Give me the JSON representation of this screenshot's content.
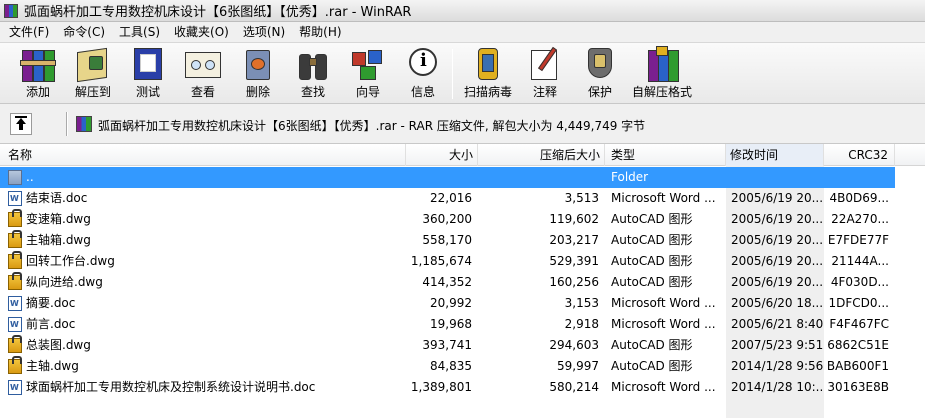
{
  "window": {
    "title": "弧面蜗杆加工专用数控机床设计【6张图纸】【优秀】.rar - WinRAR"
  },
  "menu": [
    "文件(F)",
    "命令(C)",
    "工具(S)",
    "收藏夹(O)",
    "选项(N)",
    "帮助(H)"
  ],
  "toolbar": {
    "buttons": [
      {
        "label": "添加",
        "icon": "add-books-icon"
      },
      {
        "label": "解压到",
        "icon": "extract-folder-icon"
      },
      {
        "label": "测试",
        "icon": "test-check-icon"
      },
      {
        "label": "查看",
        "icon": "view-glasses-icon"
      },
      {
        "label": "删除",
        "icon": "delete-recycle-icon"
      },
      {
        "label": "查找",
        "icon": "find-binoculars-icon"
      },
      {
        "label": "向导",
        "icon": "wizard-icon"
      },
      {
        "label": "信息",
        "icon": "info-icon"
      },
      {
        "label": "扫描病毒",
        "icon": "scan-virus-icon"
      },
      {
        "label": "注释",
        "icon": "comment-pen-icon"
      },
      {
        "label": "保护",
        "icon": "protect-shield-icon"
      },
      {
        "label": "自解压格式",
        "icon": "sfx-icon"
      }
    ]
  },
  "address": {
    "text": "弧面蜗杆加工专用数控机床设计【6张图纸】【优秀】.rar - RAR 压缩文件, 解包大小为 4,449,749 字节"
  },
  "columns": {
    "name": "名称",
    "size": "大小",
    "packed": "压缩后大小",
    "type": "类型",
    "modified": "修改时间",
    "crc": "CRC32"
  },
  "files": [
    {
      "name": "..",
      "size": "",
      "packed": "",
      "type": "Folder",
      "modified": "",
      "crc": "",
      "icon": "folder"
    },
    {
      "name": "结束语.doc",
      "size": "22,016",
      "packed": "3,513",
      "type": "Microsoft Word ...",
      "modified": "2005/6/19 20...",
      "crc": "4B0D69...",
      "icon": "word"
    },
    {
      "name": "变速箱.dwg",
      "size": "360,200",
      "packed": "119,602",
      "type": "AutoCAD 图形",
      "modified": "2005/6/19 20...",
      "crc": "22A270...",
      "icon": "dwg"
    },
    {
      "name": "主轴箱.dwg",
      "size": "558,170",
      "packed": "203,217",
      "type": "AutoCAD 图形",
      "modified": "2005/6/19 20...",
      "crc": "E7FDE77F",
      "icon": "dwg"
    },
    {
      "name": "回转工作台.dwg",
      "size": "1,185,674",
      "packed": "529,391",
      "type": "AutoCAD 图形",
      "modified": "2005/6/19 20...",
      "crc": "21144A...",
      "icon": "dwg"
    },
    {
      "name": "纵向进给.dwg",
      "size": "414,352",
      "packed": "160,256",
      "type": "AutoCAD 图形",
      "modified": "2005/6/19 20...",
      "crc": "4F030D...",
      "icon": "dwg"
    },
    {
      "name": "摘要.doc",
      "size": "20,992",
      "packed": "3,153",
      "type": "Microsoft Word ...",
      "modified": "2005/6/20 18...",
      "crc": "1DFCD0...",
      "icon": "word"
    },
    {
      "name": "前言.doc",
      "size": "19,968",
      "packed": "2,918",
      "type": "Microsoft Word ...",
      "modified": "2005/6/21 8:40",
      "crc": "F4F467FC",
      "icon": "word"
    },
    {
      "name": "总装图.dwg",
      "size": "393,741",
      "packed": "294,603",
      "type": "AutoCAD 图形",
      "modified": "2007/5/23 9:51",
      "crc": "6862C51E",
      "icon": "dwg"
    },
    {
      "name": "主轴.dwg",
      "size": "84,835",
      "packed": "59,997",
      "type": "AutoCAD 图形",
      "modified": "2014/1/28 9:56",
      "crc": "BAB600F1",
      "icon": "dwg"
    },
    {
      "name": "球面蜗杆加工专用数控机床及控制系统设计说明书.doc",
      "size": "1,389,801",
      "packed": "580,214",
      "type": "Microsoft Word ...",
      "modified": "2014/1/28 10:...",
      "crc": "30163E8B",
      "icon": "word"
    }
  ],
  "colors": {
    "selection": "#3399ff",
    "toolbar_bg": "#eeeeee"
  }
}
